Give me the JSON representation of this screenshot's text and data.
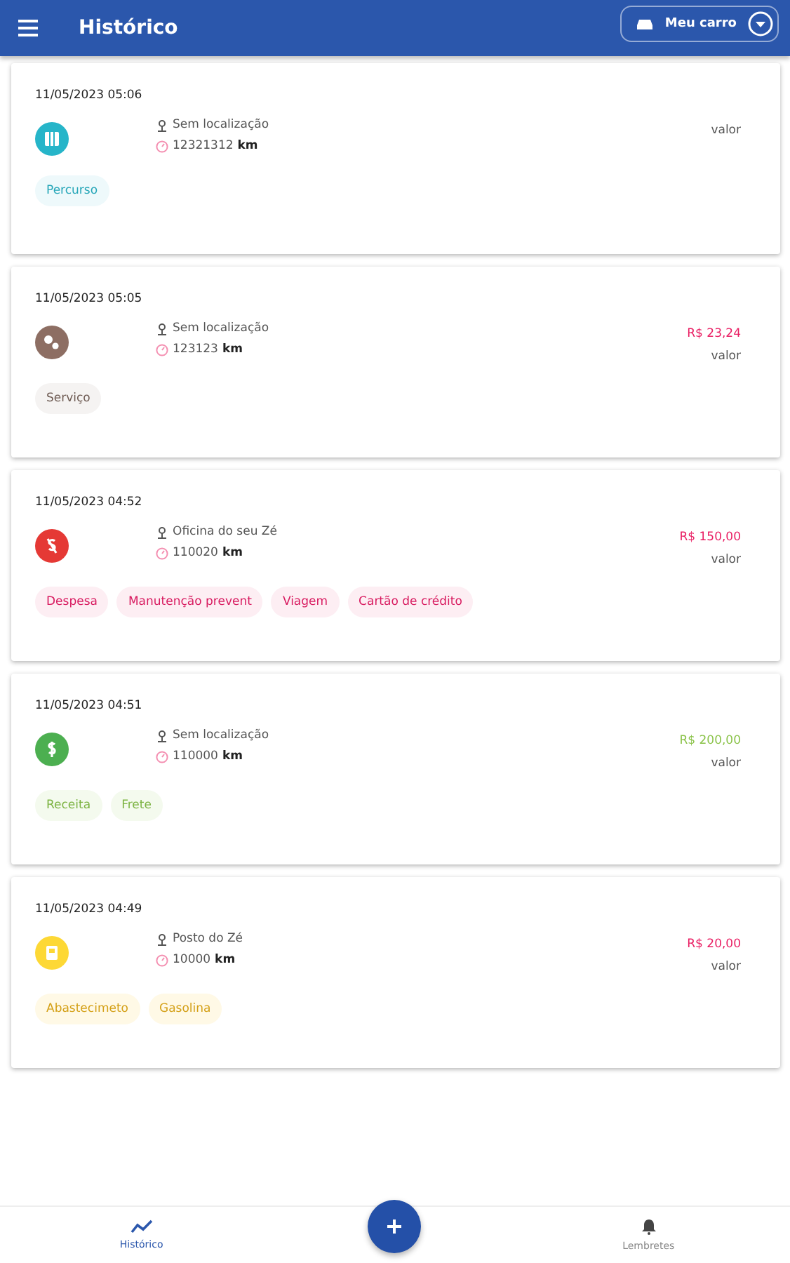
{
  "app_bar": {
    "title": "Histórico",
    "vehicle_button": "Meu carro"
  },
  "entries": [
    {
      "date": "11/05/2023 05:06",
      "kind": "route",
      "color": "#26b5c9",
      "location": "Sem localização",
      "odometer": "12321312",
      "unit": "km",
      "value_label": "valor",
      "tags": [
        "Percurso"
      ]
    },
    {
      "date": "11/05/2023 05:05",
      "kind": "service",
      "color": "#8d6e63",
      "location": "Sem localização",
      "odometer": "123123",
      "unit": "km",
      "amount": "R$ 23,24",
      "value_label": "valor",
      "tags": [
        "Serviço"
      ]
    },
    {
      "date": "11/05/2023 04:52",
      "kind": "expense",
      "color": "#e53935",
      "location": "Oficina do seu Zé",
      "odometer": "110020",
      "unit": "km",
      "amount": "R$ 150,00",
      "value_label": "valor",
      "tags": [
        "Despesa",
        "Manutenção prevent",
        "Viagem",
        "Cartão de crédito"
      ]
    },
    {
      "date": "11/05/2023 04:51",
      "kind": "income",
      "color": "#4caf50",
      "location": "Sem localização",
      "odometer": "110000",
      "unit": "km",
      "amount": "R$ 200,00",
      "value_label": "valor",
      "tags": [
        "Receita",
        "Frete"
      ]
    },
    {
      "date": "11/05/2023 04:49",
      "kind": "fuel",
      "color": "#fdd835",
      "location": "Posto do Zé",
      "odometer": "10000",
      "unit": "km",
      "amount": "R$ 20,00",
      "value_label": "valor",
      "tags": [
        "Abastecimeto",
        "Gasolina"
      ]
    }
  ],
  "bottom_nav": [
    {
      "label": "Histórico",
      "kind": "history",
      "selected": true
    },
    {
      "kind": "add"
    },
    {
      "label": "Lembretes",
      "kind": "reminders",
      "selected": false
    }
  ]
}
